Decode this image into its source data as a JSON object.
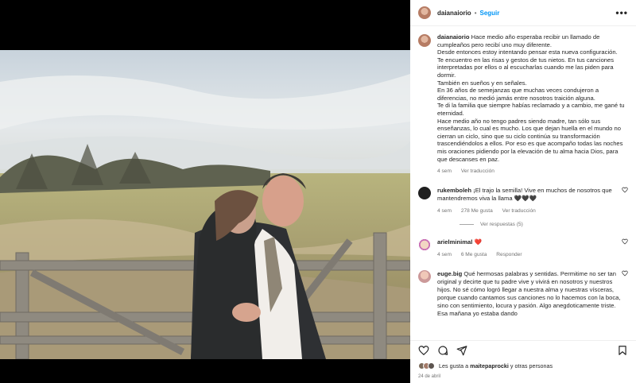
{
  "post": {
    "username": "daianaiorio",
    "follow_label": "Seguir",
    "separator": "•",
    "more_label": "•••"
  },
  "caption": {
    "username": "daianaiorio",
    "paragraphs": [
      "Hace medio año esperaba recibir un llamado de cumpleaños pero recibí uno muy diferente.",
      "Desde entonces estoy intentando pensar esta nueva configuración.",
      "Te encuentro en las risas y gestos de tus nietos. En tus canciones interpretadas por ellos o al escucharlas cuando me las piden para dormir.",
      "También en sueños y en señales.",
      "En 36 años de semejanzas que muchas veces condujeron a diferencias, no medió jamás entre nosotros traición alguna.",
      "Te di la familia que siempre habías reclamado y a cambio, me gané tu eternidad.",
      "Hace medio año no tengo padres siendo madre, tan sólo sus enseñanzas, lo cual es mucho. Los que dejan huella en el mundo no cierran un ciclo, sino que su ciclo continúa su transformación trascendiéndolos a ellos. Por eso es que acompaño todas las noches mis oraciones pidiendo por la elevación de tu alma hacia Dios, para que descanses en paz."
    ],
    "time": "4 sem",
    "translate": "Ver traducción"
  },
  "comments": [
    {
      "username": "rukemboleh",
      "text": "¡El trajo la semilla! Vive en muchos de nosotros que mantendremos viva la llama 🖤🖤🖤",
      "time": "4 sem",
      "likes": "278 Me gusta",
      "translate": "Ver traducción",
      "replies": "Ver respuestas (5)"
    },
    {
      "username": "arielminimal",
      "text": "❤️",
      "time": "4 sem",
      "likes": "6 Me gusta",
      "reply": "Responder"
    },
    {
      "username": "euge.big",
      "text": "Qué hermosas palabras y sentidas. Permitime no ser tan original y decirte que tu padre vive y vivirá en nosotros y nuestros hijos. No sé cómo logró llegar a nuestra alma y nuestras vísceras, porque cuando cantamos sus canciones no lo hacemos con la boca, sino con sentimiento, locura y pasión. Algo anegdoticamente triste. Esa mañana yo estaba dando"
    }
  ],
  "footer": {
    "likes_prefix": "Les gusta a ",
    "likes_user": "maitepaprocki",
    "likes_suffix": " y otras personas",
    "date": "24 de abril"
  },
  "icons": [
    "heart-icon",
    "comment-icon",
    "share-icon",
    "bookmark-icon",
    "more-icon"
  ]
}
